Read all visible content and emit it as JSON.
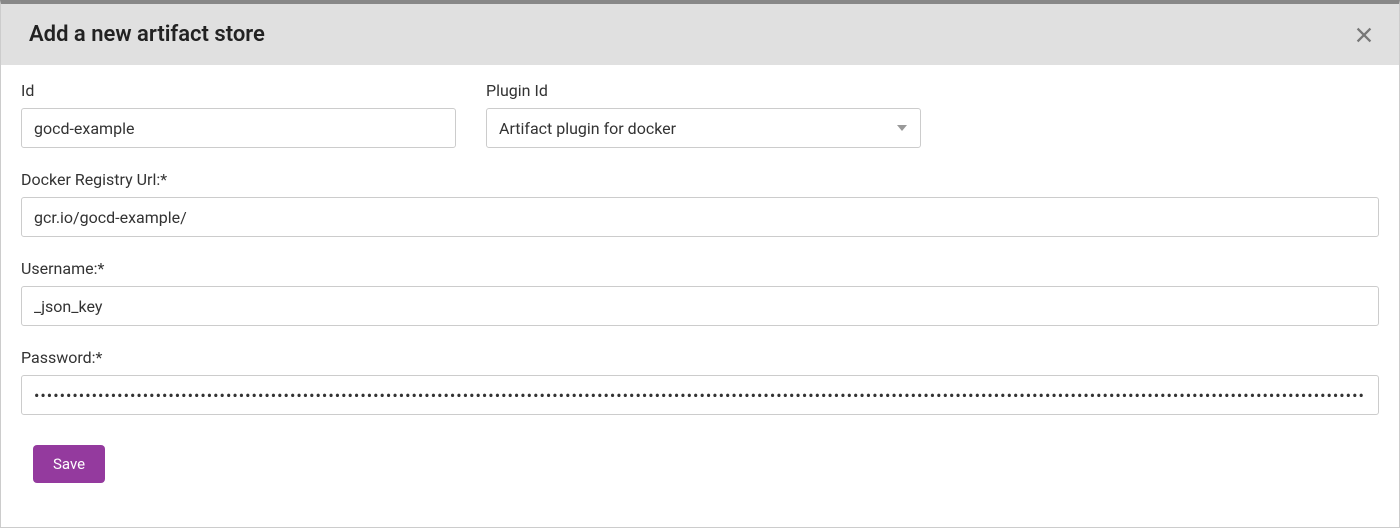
{
  "header": {
    "title": "Add a new artifact store"
  },
  "fields": {
    "id": {
      "label": "Id",
      "value": "gocd-example"
    },
    "plugin": {
      "label": "Plugin Id",
      "selected": "Artifact plugin for docker"
    },
    "registryUrl": {
      "label": "Docker Registry Url:*",
      "value": "gcr.io/gocd-example/"
    },
    "username": {
      "label": "Username:*",
      "value": "_json_key"
    },
    "password": {
      "label": "Password:*",
      "value": "••••••••••••••••••••••••••••••••••••••••••••••••••••••••••••••••••••••••••••••••••••••••••••••••••••••••••••••••••••••••••••••••••••••••••••••••••••••••••••••••••••••••••••••••••••••••••••••••••••••••••••••••••••••••••••••••••••••••••••••••••••••••••••••••••••••••••••••••••••••••••••••••••••••••••••••••••••••••••••••••••••••••••••••••••••••••••••••••••••••••••••••••••••••••••••••••••••"
    }
  },
  "buttons": {
    "save": "Save"
  }
}
